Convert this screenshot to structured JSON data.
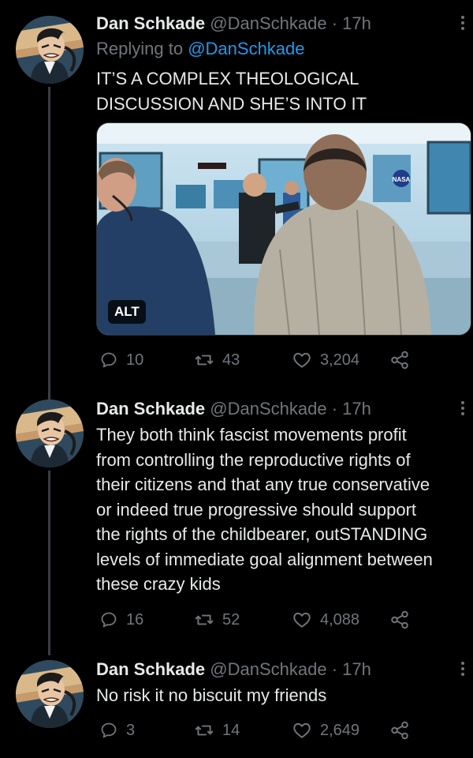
{
  "tweets": [
    {
      "name": "Dan Schkade",
      "handle": "@DanSchkade",
      "time": "· 17h",
      "replying_label": "Replying to",
      "replying_handle": "@DanSchkade",
      "lines": [
        "IT’S A COMPLEX THEOLOGICAL",
        "DISCUSSION AND SHE’S INTO IT"
      ],
      "media_alt_badge": "ALT",
      "media_logo": "NASA",
      "replies": "10",
      "retweets": "43",
      "likes": "3,204"
    },
    {
      "name": "Dan Schkade",
      "handle": "@DanSchkade",
      "time": "· 17h",
      "lines": [
        "They both think fascist movements profit",
        "from controlling the reproductive rights of",
        "their citizens and that any true conservative",
        "or indeed true progressive should support",
        "the rights of the childbearer, outSTANDING",
        "levels of immediate goal alignment between",
        "these crazy kids"
      ],
      "replies": "16",
      "retweets": "52",
      "likes": "4,088"
    },
    {
      "name": "Dan Schkade",
      "handle": "@DanSchkade",
      "time": "· 17h",
      "lines": [
        "No risk it no biscuit my friends"
      ],
      "replies": "3",
      "retweets": "14",
      "likes": "2,649"
    }
  ],
  "icons": {
    "reply": "reply-icon",
    "retweet": "retweet-icon",
    "like": "heart-icon",
    "share": "share-icon",
    "more": "more-icon"
  },
  "colors": {
    "background": "#000000",
    "text": "#e7e9ea",
    "muted": "#71767b",
    "link": "#1d9bf0",
    "thread_line": "#3a3f44"
  }
}
